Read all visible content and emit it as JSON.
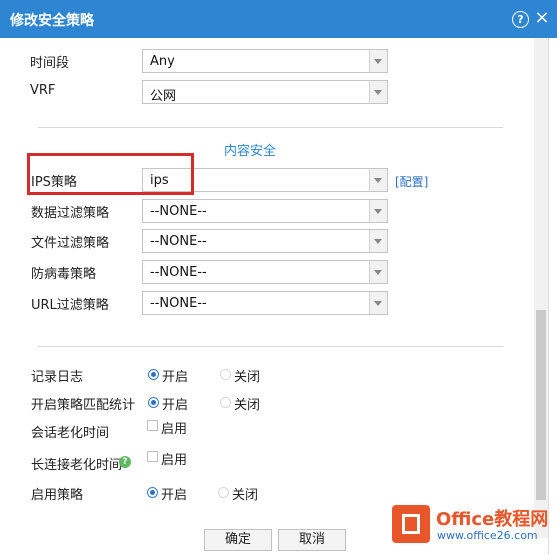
{
  "dialog": {
    "title": "修改安全策略",
    "help_glyph": "?",
    "close_glyph": "×"
  },
  "fields": {
    "time_range": {
      "label": "时间段",
      "value": "Any"
    },
    "vrf": {
      "label": "VRF",
      "value": "公网"
    }
  },
  "content_security": {
    "section_title": "内容安全",
    "ips": {
      "label": "IPS策略",
      "value": "ips",
      "config_link": "[配置]"
    },
    "data_filter": {
      "label": "数据过滤策略",
      "value": "--NONE--"
    },
    "file_filter": {
      "label": "文件过滤策略",
      "value": "--NONE--"
    },
    "antivirus": {
      "label": "防病毒策略",
      "value": "--NONE--"
    },
    "url_filter": {
      "label": "URL过滤策略",
      "value": "--NONE--"
    }
  },
  "options": {
    "log": {
      "label": "记录日志",
      "on": "开启",
      "off": "关闭",
      "selected": "on"
    },
    "match_stats": {
      "label": "开启策略匹配统计",
      "on": "开启",
      "off": "关闭",
      "selected": "on"
    },
    "session_aging": {
      "label": "会话老化时间",
      "checkbox_label": "启用",
      "checked": false
    },
    "long_conn_aging": {
      "label": "长连接老化时间",
      "checkbox_label": "启用",
      "checked": false,
      "help_icon": "?"
    },
    "enable_policy": {
      "label": "启用策略",
      "on": "开启",
      "off": "关闭",
      "selected": "on"
    }
  },
  "buttons": {
    "ok": "确定",
    "cancel": "取消"
  },
  "watermark": {
    "name": "Office教程网",
    "url": "www.office26.com"
  },
  "colors": {
    "titlebar": "#2e86d3",
    "highlight": "#d62b2b",
    "link": "#2e6fc0",
    "watermark": "#e8562a"
  }
}
